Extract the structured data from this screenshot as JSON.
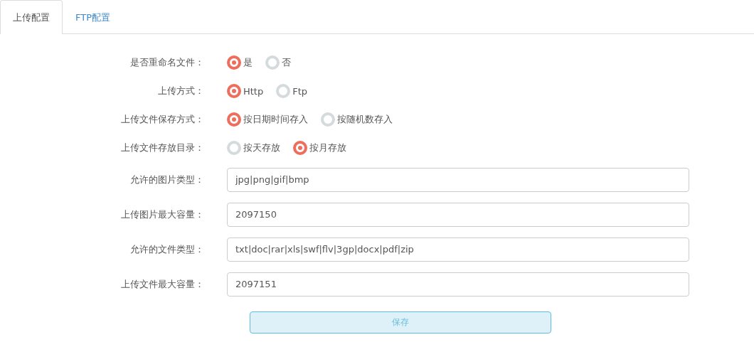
{
  "tabs": [
    {
      "label": "上传配置",
      "selected": true
    },
    {
      "label": "FTP配置",
      "selected": false
    }
  ],
  "fields": [
    {
      "kind": "radio",
      "label": "是否重命名文件：",
      "options": [
        {
          "label": "是",
          "selected": true
        },
        {
          "label": "否",
          "selected": false
        }
      ]
    },
    {
      "kind": "radio",
      "label": "上传方式：",
      "options": [
        {
          "label": "Http",
          "selected": true
        },
        {
          "label": "Ftp",
          "selected": false
        }
      ]
    },
    {
      "kind": "radio",
      "label": "上传文件保存方式：",
      "options": [
        {
          "label": "按日期时间存入",
          "selected": true
        },
        {
          "label": "按随机数存入",
          "selected": false
        }
      ]
    },
    {
      "kind": "radio",
      "label": "上传文件存放目录：",
      "options": [
        {
          "label": "按天存放",
          "selected": false
        },
        {
          "label": "按月存放",
          "selected": true
        }
      ]
    },
    {
      "kind": "text",
      "label": "允许的图片类型：",
      "value": "jpg|png|gif|bmp"
    },
    {
      "kind": "text",
      "label": "上传图片最大容量：",
      "value": "2097150"
    },
    {
      "kind": "text",
      "label": "允许的文件类型：",
      "value": "txt|doc|rar|xls|swf|flv|3gp|docx|pdf|zip"
    },
    {
      "kind": "text",
      "label": "上传文件最大容量：",
      "value": "2097151"
    }
  ],
  "save_button": "保存"
}
